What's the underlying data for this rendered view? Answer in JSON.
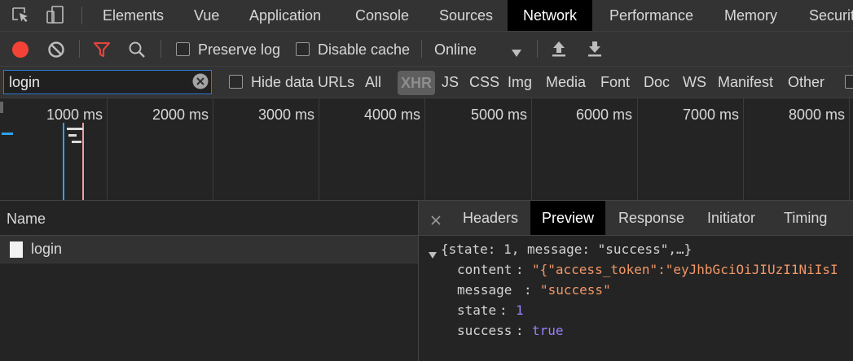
{
  "devtools": {
    "tabs": [
      "Elements",
      "Vue",
      "Application",
      "Console",
      "Sources",
      "Network",
      "Performance",
      "Memory",
      "Securit"
    ],
    "active_tab": "Network"
  },
  "toolbar": {
    "preserve_log": "Preserve log",
    "disable_cache": "Disable cache",
    "throttling": "Online",
    "record_color": "#f44336",
    "filter_icon_color": "#e0443e",
    "icons": [
      "record-icon",
      "clear-icon",
      "filter-icon",
      "search-icon",
      "upload-icon",
      "download-icon"
    ]
  },
  "filter": {
    "value": "login",
    "hide_data_urls": "Hide data URLs",
    "types": [
      "All",
      "XHR",
      "JS",
      "CSS",
      "Img",
      "Media",
      "Font",
      "Doc",
      "WS",
      "Manifest",
      "Other"
    ],
    "selected_type": "XHR"
  },
  "timeline": {
    "ticks": [
      "1000 ms",
      "2000 ms",
      "3000 ms",
      "4000 ms",
      "5000 ms",
      "6000 ms",
      "7000 ms",
      "8000 ms"
    ]
  },
  "requests": {
    "header": "Name",
    "items": [
      {
        "name": "login"
      }
    ]
  },
  "details": {
    "tabs": [
      "Headers",
      "Preview",
      "Response",
      "Initiator",
      "Timing"
    ],
    "active_tab": "Preview",
    "preview": {
      "summary": "{state: 1, message: \"success\",…}",
      "content_key": "content",
      "content_value": "\"{\"access_token\":\"eyJhbGciOiJIUzI1NiIsI",
      "message_key": "message",
      "message_value": "\"success\"",
      "state_key": "state",
      "state_value": "1",
      "success_key": "success",
      "success_value": "true"
    }
  }
}
